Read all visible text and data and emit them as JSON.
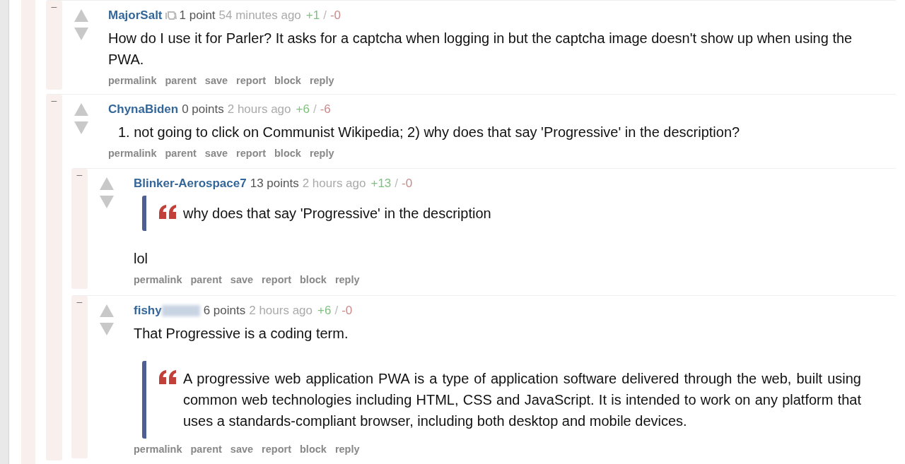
{
  "comments": [
    {
      "collapse": "–",
      "author": "MajorSalt",
      "flair": true,
      "redacted": false,
      "points": "1 point",
      "time": "54 minutes ago",
      "up": "+1",
      "sep": "/",
      "down": "-0",
      "body": [
        {
          "kind": "text",
          "text": "How do I use it for Parler? It asks for a captcha when logging in but the captcha image doesn't show up when using the PWA."
        }
      ],
      "actions": [
        "permalink",
        "parent",
        "save",
        "report",
        "block",
        "reply"
      ]
    },
    {
      "collapse": "–",
      "author": "ChynaBiden",
      "flair": false,
      "redacted": false,
      "points": "0 points",
      "time": "2 hours ago",
      "up": "+6",
      "sep": "/",
      "down": "-6",
      "body": [
        {
          "kind": "list",
          "text": "1. not going to click on Communist Wikipedia; 2) why does that say 'Progressive' in the description?"
        }
      ],
      "actions": [
        "permalink",
        "parent",
        "save",
        "report",
        "block",
        "reply"
      ],
      "children": [
        {
          "collapse": "–",
          "author": "Blinker-Aerospace7",
          "flair": false,
          "redacted": false,
          "points": "13 points",
          "time": "2 hours ago",
          "up": "+13",
          "sep": "/",
          "down": "-0",
          "body": [
            {
              "kind": "quote",
              "text": "why does that say 'Progressive' in the description"
            },
            {
              "kind": "text",
              "text": "lol"
            }
          ],
          "actions": [
            "permalink",
            "parent",
            "save",
            "report",
            "block",
            "reply"
          ]
        },
        {
          "collapse": "–",
          "author": "fishy",
          "flair": false,
          "redacted": true,
          "points": "6 points",
          "time": "2 hours ago",
          "up": "+6",
          "sep": "/",
          "down": "-0",
          "body": [
            {
              "kind": "text",
              "text": "That Progressive is a coding term."
            },
            {
              "kind": "quote",
              "text": "A progressive web application PWA is a type of application software delivered through the web, built using common web technologies including HTML, CSS and JavaScript. It is intended to work on any platform that uses a standards-compliant browser, including both desktop and mobile devices."
            }
          ],
          "actions": [
            "permalink",
            "parent",
            "save",
            "report",
            "block",
            "reply"
          ]
        }
      ]
    }
  ]
}
